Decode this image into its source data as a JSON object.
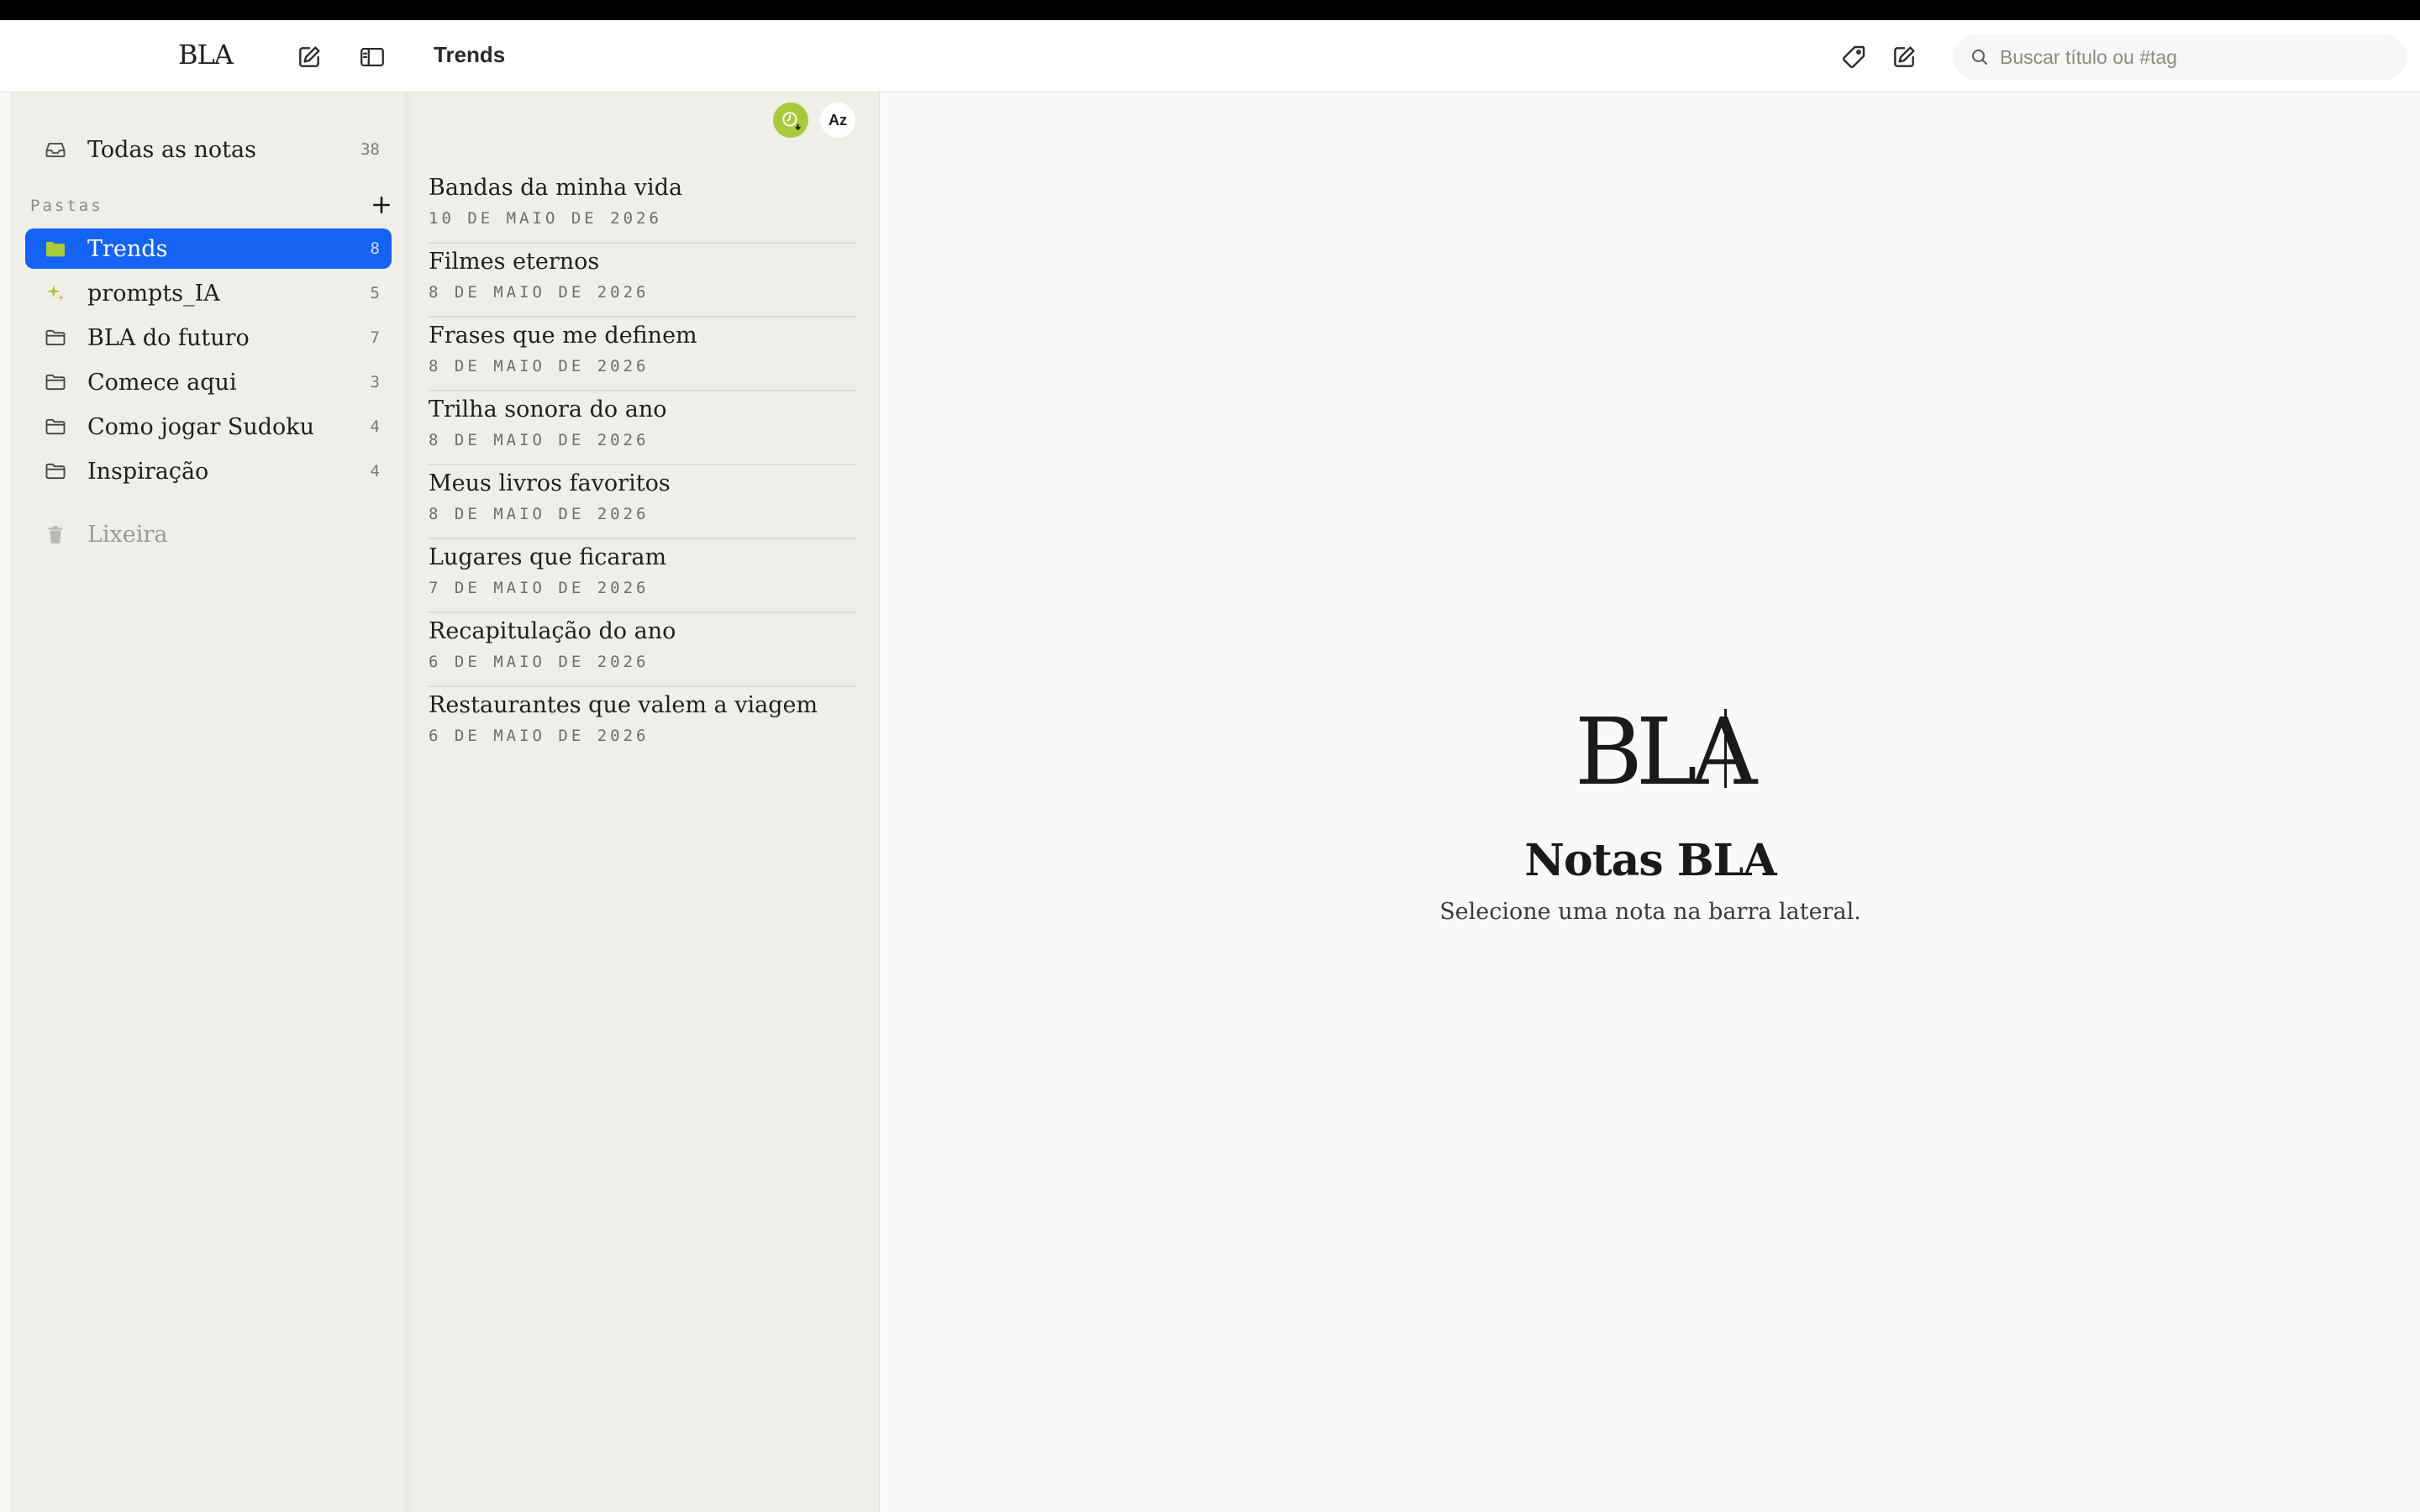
{
  "header": {
    "logo": "BLA",
    "title": "Trends",
    "search_placeholder": "Buscar título ou #tag"
  },
  "sidebar": {
    "all_notes": {
      "label": "Todas as notas",
      "count": "38"
    },
    "folders_label": "Pastas",
    "folders": [
      {
        "label": "Trends",
        "count": "8",
        "icon": "folder-green-icon",
        "active": true
      },
      {
        "label": "prompts_IA",
        "count": "5",
        "icon": "sparkle-icon"
      },
      {
        "label": "BLA do futuro",
        "count": "7",
        "icon": "folder-icon"
      },
      {
        "label": "Comece aqui",
        "count": "3",
        "icon": "folder-icon"
      },
      {
        "label": "Como jogar Sudoku",
        "count": "4",
        "icon": "folder-icon"
      },
      {
        "label": "Inspiração",
        "count": "4",
        "icon": "folder-icon"
      }
    ],
    "trash": {
      "label": "Lixeira"
    }
  },
  "notelist": {
    "sort_az_label": "Az",
    "notes": [
      {
        "title": "Bandas da minha vida",
        "date": "10 DE MAIO DE 2026"
      },
      {
        "title": "Filmes eternos",
        "date": "8 DE MAIO DE 2026"
      },
      {
        "title": "Frases que me definem",
        "date": "8 DE MAIO DE 2026"
      },
      {
        "title": "Trilha sonora do ano",
        "date": "8 DE MAIO DE 2026"
      },
      {
        "title": "Meus livros favoritos",
        "date": "8 DE MAIO DE 2026"
      },
      {
        "title": "Lugares que ficaram",
        "date": "7 DE MAIO DE 2026"
      },
      {
        "title": "Recapitulação do ano",
        "date": "6 DE MAIO DE 2026"
      },
      {
        "title": "Restaurantes que valem a viagem",
        "date": "6 DE MAIO DE 2026"
      }
    ]
  },
  "main": {
    "logo": "BLA",
    "title": "Notas BLA",
    "subtitle": "Selecione uma nota na barra lateral."
  },
  "colors": {
    "accent": "#1463f3",
    "folder_green": "#a8c93a",
    "sidebar_bg": "#efeee9",
    "main_bg": "#f9f9f7"
  }
}
